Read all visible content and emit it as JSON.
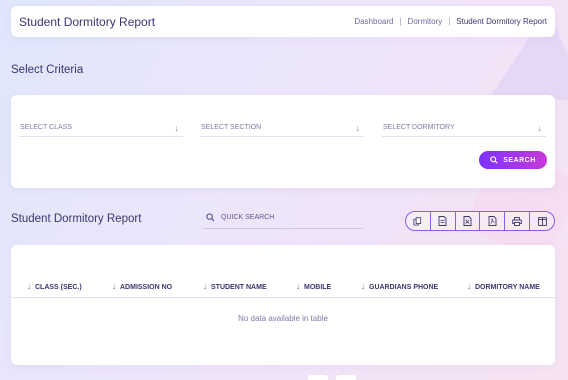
{
  "header": {
    "title": "Student Dormitory Report",
    "breadcrumb": [
      "Dashboard",
      "Dormitory",
      "Student Dormitory Report"
    ],
    "separator": "|"
  },
  "criteria": {
    "title": "Select Criteria",
    "selects": [
      {
        "placeholder": "SELECT CLASS",
        "icon": "arrow-down-icon"
      },
      {
        "placeholder": "SELECT SECTION",
        "icon": "arrow-down-icon"
      },
      {
        "placeholder": "SELECT DORMITORY",
        "icon": "arrow-down-icon"
      }
    ],
    "search_label": "SEARCH",
    "search_icon": "search-icon"
  },
  "report": {
    "title": "Student Dormitory Report",
    "quick_search_placeholder": "QUICK SEARCH",
    "toolbar": [
      "copy-icon",
      "csv-icon",
      "excel-icon",
      "pdf-icon",
      "print-icon",
      "columns-icon"
    ],
    "columns": [
      "CLASS (SEC.)",
      "ADMISSION NO",
      "STUDENT NAME",
      "MOBILE",
      "GUARDIANS PHONE",
      "DORMITORY NAME"
    ],
    "empty_text": "No data available in table"
  },
  "colors": {
    "accent_start": "#7c32ff",
    "accent_end": "#c738d8",
    "text": "#3b3570"
  }
}
